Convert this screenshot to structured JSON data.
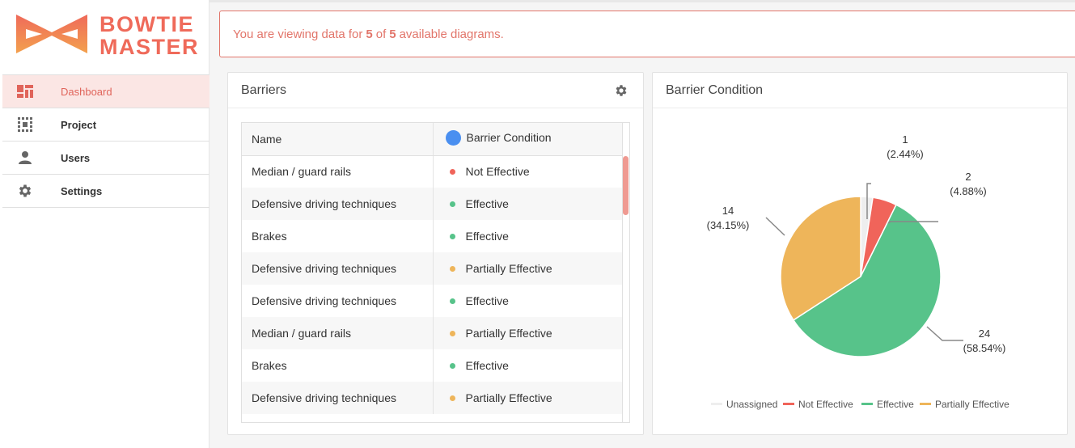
{
  "brand": {
    "line1": "BOWTIE",
    "line2": "MASTER",
    "color": "#ef6a5a"
  },
  "sidebar": {
    "items": [
      {
        "label": "Dashboard",
        "icon": "dashboard-icon",
        "active": true
      },
      {
        "label": "Project",
        "icon": "project-grid-icon",
        "active": false
      },
      {
        "label": "Users",
        "icon": "user-icon",
        "active": false
      },
      {
        "label": "Settings",
        "icon": "gear-icon",
        "active": false
      }
    ]
  },
  "alert": {
    "prefix": "You are viewing data for",
    "current": "5",
    "of": "of",
    "total": "5",
    "suffix": "available diagrams."
  },
  "barriers": {
    "title": "Barriers",
    "columns": {
      "name": "Name",
      "condition": "Barrier Condition"
    },
    "rows": [
      {
        "name": "Median / guard rails",
        "condition": "Not Effective"
      },
      {
        "name": "Defensive driving techniques",
        "condition": "Effective"
      },
      {
        "name": "Brakes",
        "condition": "Effective"
      },
      {
        "name": "Defensive driving techniques",
        "condition": "Partially Effective"
      },
      {
        "name": "Defensive driving techniques",
        "condition": "Effective"
      },
      {
        "name": "Median / guard rails",
        "condition": "Partially Effective"
      },
      {
        "name": "Brakes",
        "condition": "Effective"
      },
      {
        "name": "Defensive driving techniques",
        "condition": "Partially Effective"
      }
    ]
  },
  "condition_colors": {
    "Unassigned": "#eeeeee",
    "Not Effective": "#f0645a",
    "Effective": "#57c38a",
    "Partially Effective": "#eeb55a"
  },
  "condition_panel": {
    "title": "Barrier Condition"
  },
  "chart_data": {
    "type": "pie",
    "labels": [
      "Unassigned",
      "Not Effective",
      "Effective",
      "Partially Effective"
    ],
    "values": [
      1,
      2,
      24,
      14
    ],
    "percent_labels": [
      "(2.44%)",
      "(4.88%)",
      "(58.54%)",
      "(34.15%)"
    ],
    "colors": [
      "#eeeeee",
      "#f0645a",
      "#57c38a",
      "#eeb55a"
    ],
    "legend": {
      "position": "bottom",
      "entries": [
        "Unassigned",
        "Not Effective",
        "Effective",
        "Partially Effective"
      ]
    }
  }
}
